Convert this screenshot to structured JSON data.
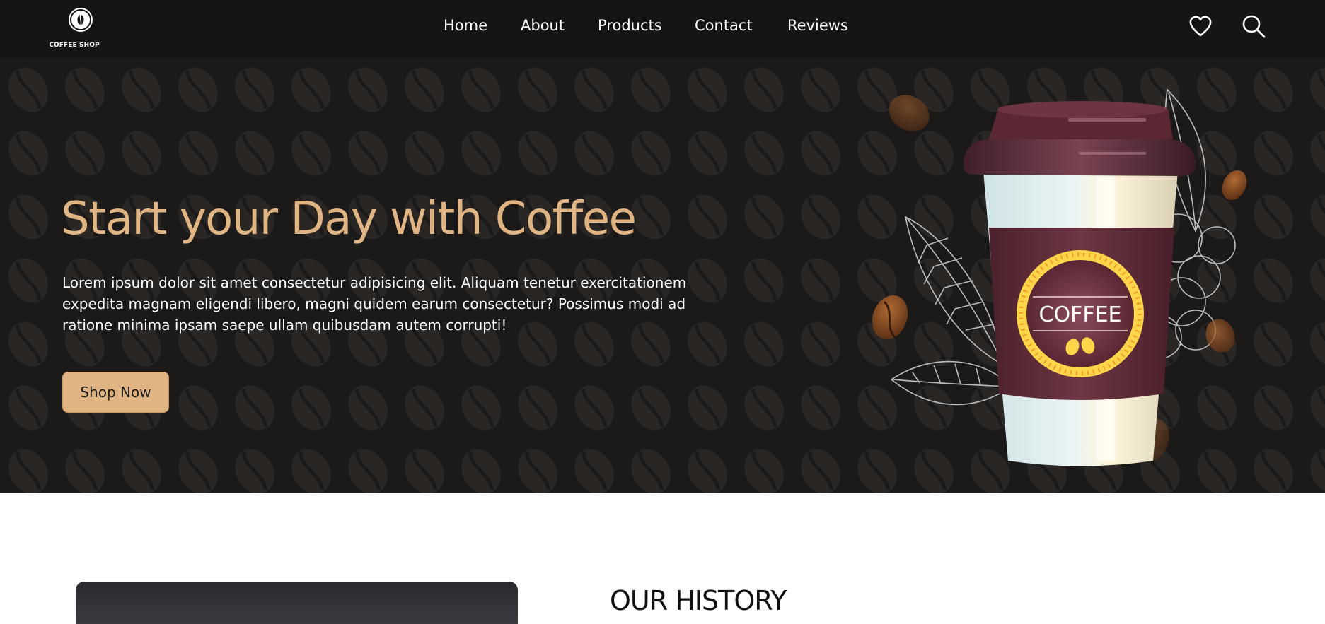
{
  "logo": {
    "text": "COFFEE SHOP",
    "icon": "coffee-bean-icon"
  },
  "nav": {
    "links": [
      {
        "label": "Home"
      },
      {
        "label": "About"
      },
      {
        "label": "Products"
      },
      {
        "label": "Contact"
      },
      {
        "label": "Reviews"
      }
    ],
    "icons": [
      "heart-icon",
      "search-icon"
    ]
  },
  "hero": {
    "title": "Start your Day with Coffee",
    "text": "Lorem ipsum dolor sit amet consectetur adipisicing elit. Aliquam tenetur exercitationem expedita magnam eligendi libero, magni quidem earum consectetur? Possimus modi ad ratione minima ipsam saepe ullam quibusdam autem corrupti!",
    "button": "Shop Now",
    "cup_label": "COFFEE"
  },
  "history": {
    "title": "OUR HISTORY"
  },
  "colors": {
    "accent": "#e1b583",
    "dark_bg": "#1c1a19",
    "nav_bg": "#161514",
    "cup_sleeve": "#5b2a35"
  }
}
